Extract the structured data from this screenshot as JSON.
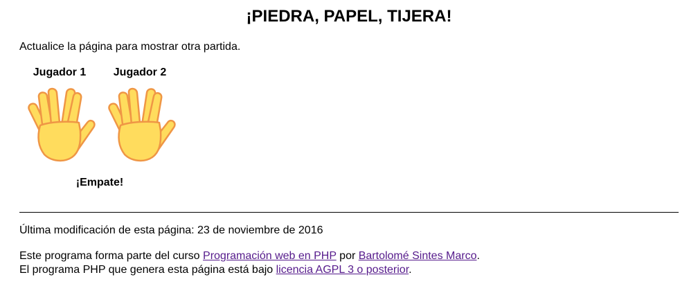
{
  "page": {
    "title": "¡PIEDRA, PAPEL, TIJERA!",
    "instructions": "Actualice la página para mostrar otra partida."
  },
  "game": {
    "player1_label": "Jugador 1",
    "player2_label": "Jugador 2",
    "player1_hand_icon": "vulcan-salute-hand-icon",
    "player2_hand_icon": "vulcan-salute-hand-icon",
    "result": "¡Empate!"
  },
  "footer": {
    "modified_text": "Última modificación de esta página: 23 de noviembre de 2016",
    "line1_prefix": "Este programa forma parte del curso ",
    "course_link": "Programación web en PHP",
    "line1_middle": " por ",
    "author_link": "Bartolomé Sintes Marco",
    "line1_suffix": ".",
    "line2_prefix": "El programa PHP que genera esta página está bajo ",
    "license_link": "licencia AGPL 3 o posterior",
    "line2_suffix": "."
  },
  "colors": {
    "visited_link": "#551a8b",
    "hand_fill": "#FFDC5D",
    "hand_shade": "#EF9645"
  }
}
